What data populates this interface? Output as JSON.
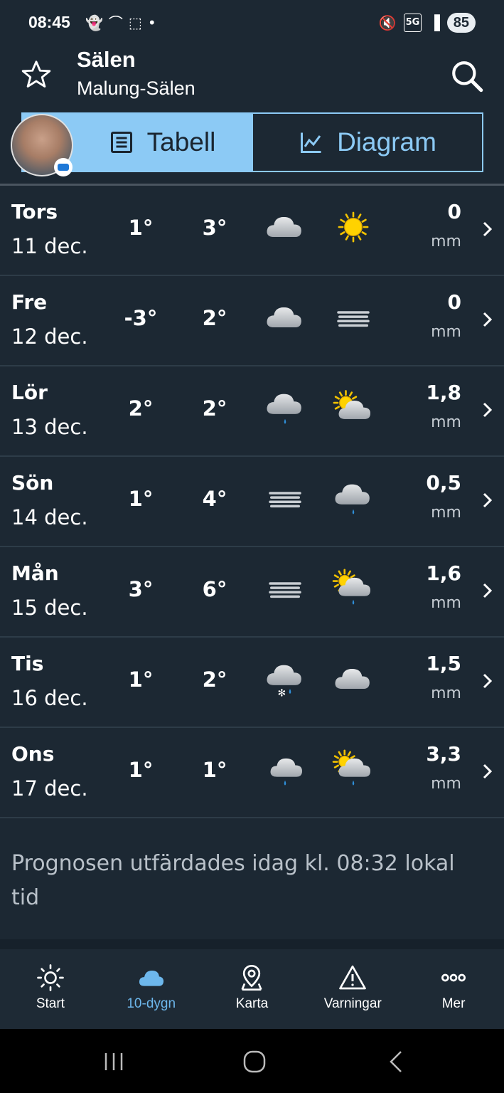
{
  "status": {
    "time": "08:45",
    "battery": "85",
    "network": "5G"
  },
  "header": {
    "title": "Sälen",
    "subtitle": "Malung-Sälen"
  },
  "toggle": {
    "table_label": "Tabell",
    "diagram_label": "Diagram"
  },
  "rows": [
    {
      "day": "Tors",
      "date": "11 dec.",
      "tmin": "1°",
      "tmax": "3°",
      "icon1": "cloud-icon",
      "icon2": "sun-icon",
      "precip": "0",
      "unit": "mm"
    },
    {
      "day": "Fre",
      "date": "12 dec.",
      "tmin": "-3°",
      "tmax": "2°",
      "icon1": "cloud-icon",
      "icon2": "fog-icon",
      "precip": "0",
      "unit": "mm"
    },
    {
      "day": "Lör",
      "date": "13 dec.",
      "tmin": "2°",
      "tmax": "2°",
      "icon1": "rain-cloud-icon",
      "icon2": "partly-cloudy-icon",
      "precip": "1,8",
      "unit": "mm"
    },
    {
      "day": "Sön",
      "date": "14 dec.",
      "tmin": "1°",
      "tmax": "4°",
      "icon1": "fog-icon",
      "icon2": "rain-cloud-icon",
      "precip": "0,5",
      "unit": "mm"
    },
    {
      "day": "Mån",
      "date": "15 dec.",
      "tmin": "3°",
      "tmax": "6°",
      "icon1": "fog-icon",
      "icon2": "sun-rain-cloud-icon",
      "precip": "1,6",
      "unit": "mm"
    },
    {
      "day": "Tis",
      "date": "16 dec.",
      "tmin": "1°",
      "tmax": "2°",
      "icon1": "sleet-cloud-icon",
      "icon2": "cloud-icon",
      "precip": "1,5",
      "unit": "mm"
    },
    {
      "day": "Ons",
      "date": "17 dec.",
      "tmin": "1°",
      "tmax": "1°",
      "icon1": "moon-rain-cloud-icon",
      "icon2": "sun-rain-cloud-icon",
      "precip": "3,3",
      "unit": "mm"
    }
  ],
  "footnote": "Prognosen utfärdades idag kl. 08:32 lokal tid",
  "nav": {
    "start": "Start",
    "tendays": "10-dygn",
    "map": "Karta",
    "warnings": "Varningar",
    "more": "Mer"
  },
  "colors": {
    "background": "#1c2833",
    "accent": "#8ccaf5",
    "active_nav": "#6db7ec"
  }
}
